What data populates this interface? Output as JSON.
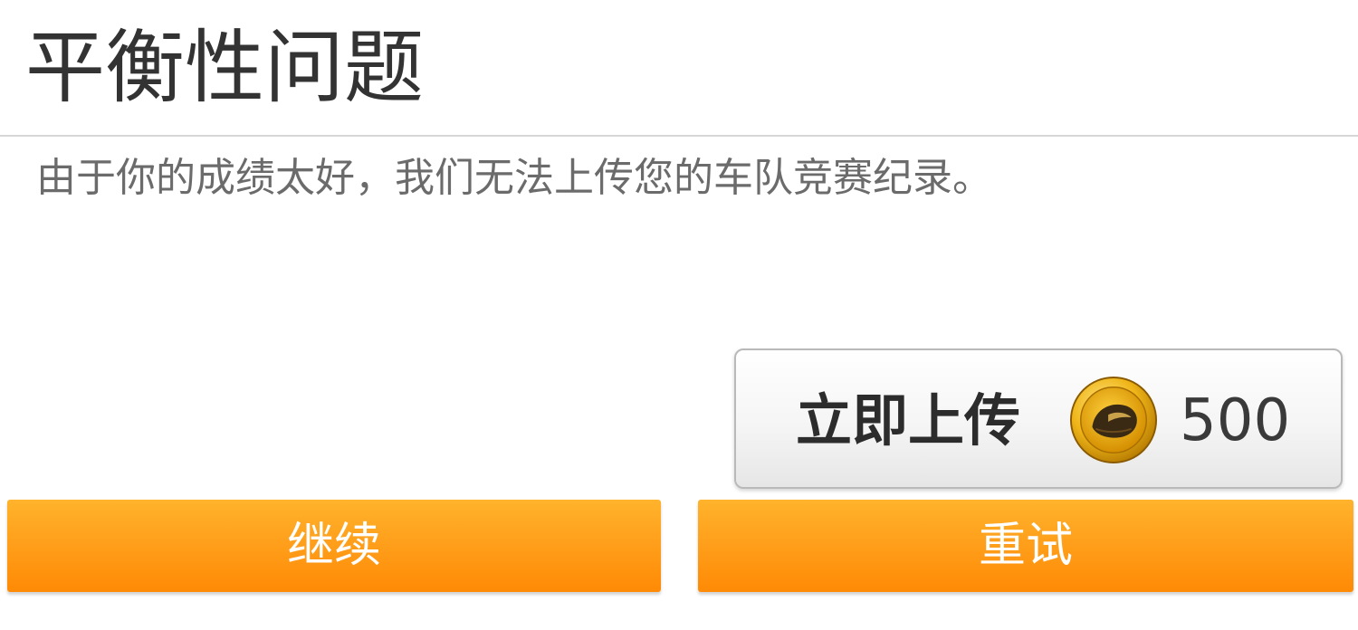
{
  "dialog": {
    "title": "平衡性问题",
    "message": "由于你的成绩太好，我们无法上传您的车队竞赛纪录。"
  },
  "upload_button": {
    "label": "立即上传",
    "currency_icon": "gold-coin-icon",
    "cost": "500"
  },
  "buttons": {
    "continue_label": "继续",
    "retry_label": "重试"
  },
  "colors": {
    "accent_orange": "#ff9a12",
    "coin_gold": "#e1a60a",
    "title_text": "#333333",
    "message_text": "#6b6b6b"
  }
}
